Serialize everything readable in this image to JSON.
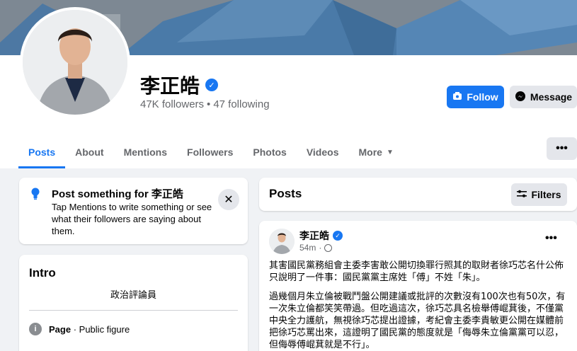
{
  "profile": {
    "name": "李正皓",
    "followers": "47K followers",
    "separator": "•",
    "following": "47 following",
    "follow_label": "Follow",
    "message_label": "Message"
  },
  "tabs": [
    {
      "label": "Posts"
    },
    {
      "label": "About"
    },
    {
      "label": "Mentions"
    },
    {
      "label": "Followers"
    },
    {
      "label": "Photos"
    },
    {
      "label": "Videos"
    },
    {
      "label": "More"
    }
  ],
  "prompt": {
    "title": "Post something for 李正皓",
    "body": "Tap Mentions to write something or see what their followers are saying about them."
  },
  "intro": {
    "title": "Intro",
    "bio": "政治評論員",
    "category_prefix": "Page",
    "category_value": "Public figure"
  },
  "posts_section": {
    "title": "Posts",
    "filters_label": "Filters"
  },
  "post": {
    "author": "李正皓",
    "time": "54m",
    "paragraph1": "其害國民黨務組會主委李害敢公開切換罪行照其的取財者徐巧芯名什公佈只說明了一件事：國民黨黨主席姓「傅」不姓「朱」。",
    "paragraph2": "過幾個月朱立倫被戰鬥盤公開建議或批評的次數沒有100次也有50次，有一次朱立倫都笑笑帶過。但吃過這次，徐巧芯具名檢舉傅崐萁後，不僅黨中央全力護航，無視徐巧芯提出證據，考紀會主委李貴敏更公開在媒體前把徐巧芯罵出來，這證明了國民黨的態度就是「侮辱朱立倫黨黨可以忍，但侮辱傅崐萁就是不行」。"
  },
  "colors": {
    "brand": "#1877f2",
    "background": "#f0f2f5",
    "secondary_button": "#e4e6eb",
    "muted_text": "#65676b"
  }
}
